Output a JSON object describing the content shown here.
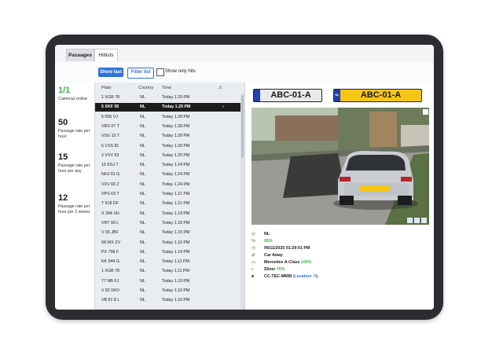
{
  "tabs": [
    {
      "label": "Passages",
      "active": true
    },
    {
      "label": "Hitlists",
      "active": false
    }
  ],
  "toolbar": {
    "show_last": "Show last",
    "filter_list": "Filter list",
    "show_only_hits": "Show only hits"
  },
  "stats": [
    {
      "value": "1/1",
      "label": "Cameras online",
      "color": "#3fae49"
    },
    {
      "value": "50",
      "label": "Passage rate per hour",
      "color": "#1a1a1a"
    },
    {
      "value": "15",
      "label": "Passage rate per hour per day",
      "color": "#1a1a1a"
    },
    {
      "value": "12",
      "label": "Passage rate per hour per 2 weeks",
      "color": "#1a1a1a"
    }
  ],
  "list": {
    "headers": {
      "plate": "Plate",
      "country": "Country",
      "time": "Time",
      "warning": "⚠"
    },
    "rows": [
      {
        "plate": "1 XGB 78",
        "country": "NL",
        "time": "Today  1.29 PM"
      },
      {
        "plate": "5 XKF 95",
        "country": "NL",
        "time": "Today  1.29 PM",
        "selected": true
      },
      {
        "plate": "5 055 VJ",
        "country": "NL",
        "time": "Today  1.28 PM"
      },
      {
        "plate": "VRX 07 T",
        "country": "NL",
        "time": "Today  1.28 PM"
      },
      {
        "plate": "VSG 15 T",
        "country": "NL",
        "time": "Today  1.28 PM"
      },
      {
        "plate": "5 VXS 81",
        "country": "NL",
        "time": "Today  1.26 PM"
      },
      {
        "plate": "2 VVV 63",
        "country": "NL",
        "time": "Today  1.25 PM"
      },
      {
        "plate": "15 KSJ 7",
        "country": "NL",
        "time": "Today  1.24 PM"
      },
      {
        "plate": "NHJ 01 G",
        "country": "NL",
        "time": "Today  1.24 PM"
      },
      {
        "plate": "VXV 60 Z",
        "country": "NL",
        "time": "Today  1.24 PM"
      },
      {
        "plate": "VPS 63 T",
        "country": "NL",
        "time": "Today  1.21 PM"
      },
      {
        "plate": "T 618 DF",
        "country": "NL",
        "time": "Today  1.21 PM"
      },
      {
        "plate": "X 394 XH",
        "country": "NL",
        "time": "Today  1.19 PM"
      },
      {
        "plate": "VRT 90 L",
        "country": "NL",
        "time": "Today  1.16 PM"
      },
      {
        "plate": "V 55 JBF",
        "country": "NL",
        "time": "Today  1.15 PM"
      },
      {
        "plate": "68 WX ZV",
        "country": "NL",
        "time": "Today  1.15 PM"
      },
      {
        "plate": "PX 798 F",
        "country": "NL",
        "time": "Today  1.14 PM"
      },
      {
        "plate": "KK 944 G",
        "country": "NL",
        "time": "Today  1.11 PM"
      },
      {
        "plate": "1 XGB 78",
        "country": "NL",
        "time": "Today  1.11 PM"
      },
      {
        "plate": "77 NB FJ",
        "country": "NL",
        "time": "Today  1.10 PM"
      },
      {
        "plate": "V 82 DKV",
        "country": "NL",
        "time": "Today  1.10 PM"
      },
      {
        "plate": "VB 61 8 L",
        "country": "NL",
        "time": "Today  1.10 PM"
      }
    ]
  },
  "detail": {
    "plate_white": "ABC-01-A",
    "plate_yellow": "ABC-01-A",
    "plate_country_badge": "NL",
    "info": {
      "country": "NL",
      "confidence": "95%",
      "datetime": "06/11/2025  01:29:01 PM",
      "direction": "Car Away",
      "make_model": "Mercedes A-Class",
      "make_model_conf": "100%",
      "color": "Silver",
      "color_conf": "76%",
      "camera": "CC-TEC-MMM",
      "location_link": "(Location",
      "location_end": ")"
    }
  },
  "colors": {
    "accent": "#2f73d8",
    "success": "#3fae49",
    "plate_yellow": "#f5c518",
    "eu_blue": "#2540a8"
  }
}
